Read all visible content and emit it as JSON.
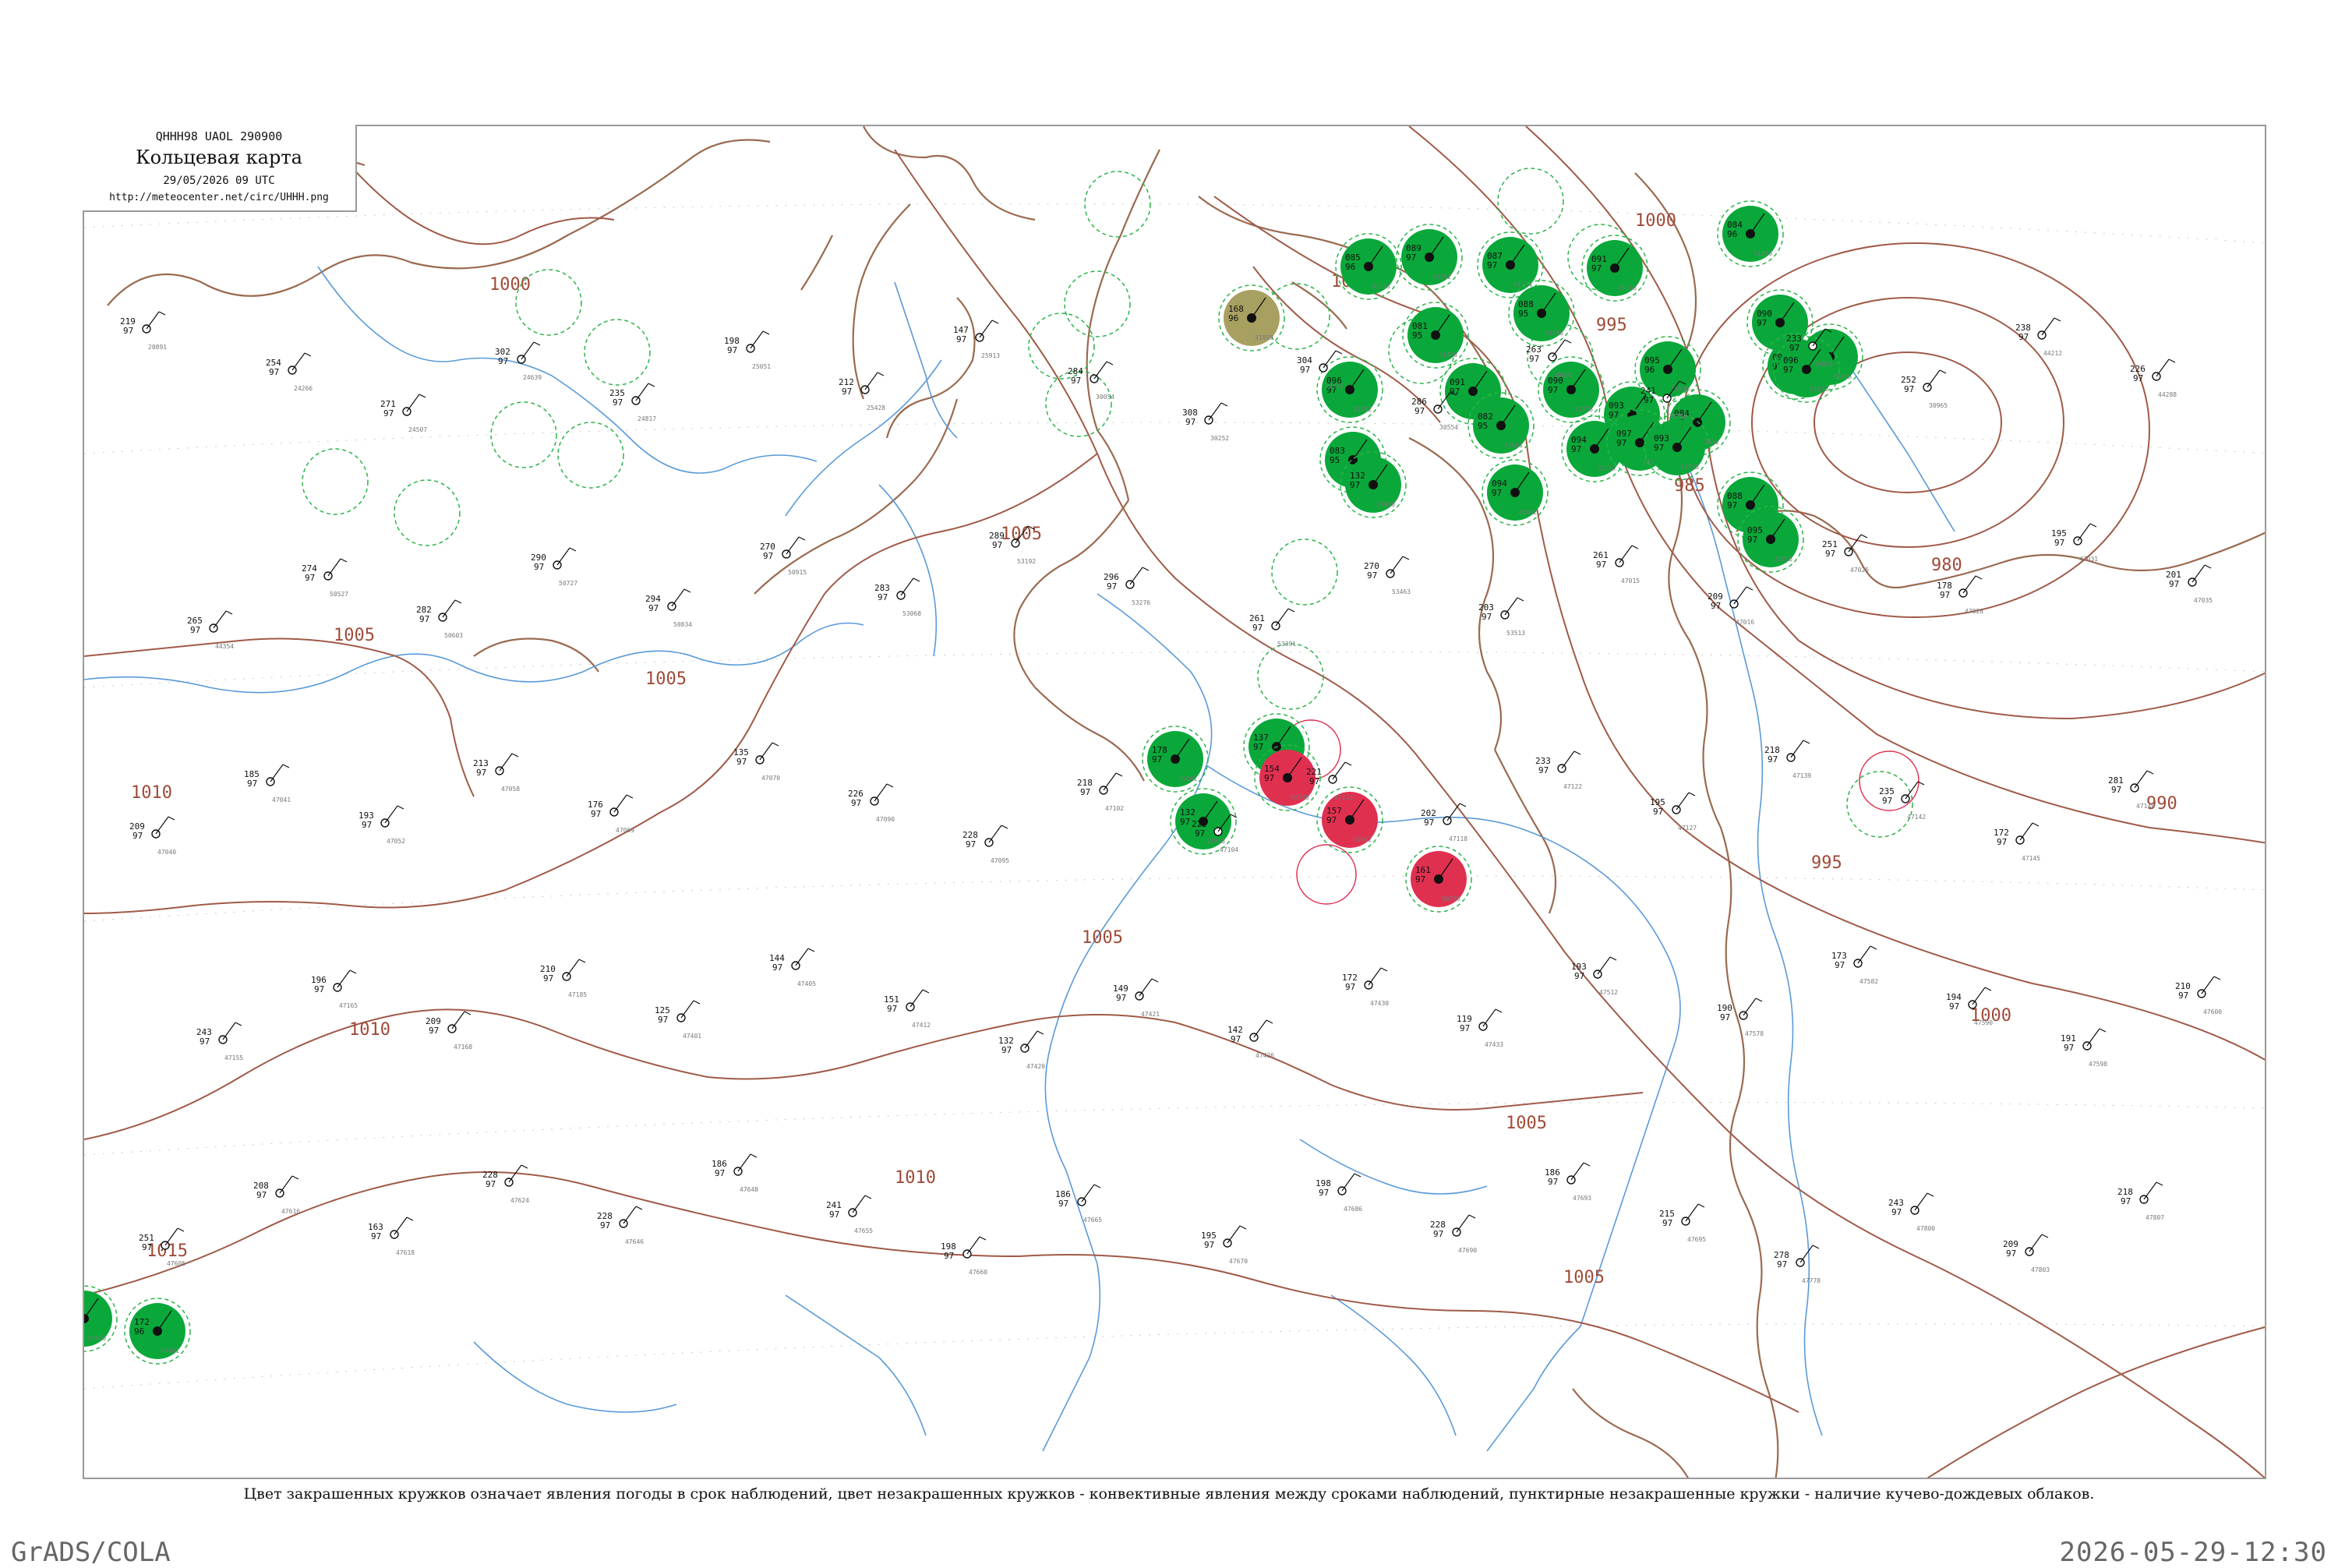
{
  "header": {
    "code": "QHHH98  UAOL  290900",
    "title": "Кольцевая карта",
    "datetime": "29/05/2026 09 UTC",
    "url": "http://meteocenter.net/circ/UHHH.png"
  },
  "caption": "Цвет закрашенных кружков означает явления погоды в срок наблюдений, цвет незакрашенных кружков - конвективные явления между сроками наблюдений, пунктирные незакрашенные кружки - наличие кучево-дождевых облаков.",
  "footer": {
    "left": "GrADS/COLA",
    "right": "2026-05-29-12:30"
  },
  "colors": {
    "isobar": "#a05a48",
    "river": "#4a90d0",
    "coast": "#9a6a50",
    "phenomenon_green": "#0aa83a",
    "phenomenon_red": "#e03050",
    "phenomenon_olive": "#a8a060",
    "cb_dashed": "#2db34a"
  },
  "isobars": [
    {
      "value": "1000"
    },
    {
      "value": "1000"
    },
    {
      "value": "1000"
    },
    {
      "value": "1000"
    },
    {
      "value": "995"
    },
    {
      "value": "995"
    },
    {
      "value": "990"
    },
    {
      "value": "985"
    },
    {
      "value": "980"
    },
    {
      "value": "1005"
    },
    {
      "value": "1005"
    },
    {
      "value": "1005"
    },
    {
      "value": "1005"
    },
    {
      "value": "1005"
    },
    {
      "value": "1005"
    },
    {
      "value": "1010"
    },
    {
      "value": "1010"
    },
    {
      "value": "1010"
    },
    {
      "value": "1015"
    }
  ],
  "stations_filled": [
    {
      "id": "47400",
      "color": "green",
      "t": "162",
      "d": "93"
    },
    {
      "id": "47401",
      "color": "green",
      "t": "172",
      "d": "96"
    },
    {
      "id": "31152",
      "color": "green",
      "t": "089",
      "d": "97"
    },
    {
      "id": "31163",
      "color": "green",
      "t": "085",
      "d": "96"
    },
    {
      "id": "31168",
      "color": "green",
      "t": "091",
      "d": "97"
    },
    {
      "id": "31174",
      "color": "green",
      "t": "087",
      "d": "97"
    },
    {
      "id": "31285",
      "color": "green",
      "t": "088",
      "d": "95"
    },
    {
      "id": "31286",
      "color": "green",
      "t": "084",
      "d": "96"
    },
    {
      "id": "31296",
      "color": "green",
      "t": "090",
      "d": "97"
    },
    {
      "id": "31304",
      "color": "green",
      "t": "092",
      "d": "97"
    },
    {
      "id": "31413",
      "color": "green",
      "t": "086",
      "d": "97"
    },
    {
      "id": "31418",
      "color": "green",
      "t": "081",
      "d": "95"
    },
    {
      "id": "31507",
      "color": "green",
      "t": "093",
      "d": "97"
    },
    {
      "id": "31510",
      "color": "green",
      "t": "095",
      "d": "96"
    },
    {
      "id": "31532",
      "color": "green",
      "t": "094",
      "d": "97"
    },
    {
      "id": "31538",
      "color": "green",
      "t": "091",
      "d": "97"
    },
    {
      "id": "31561",
      "color": "green",
      "t": "082",
      "d": "95"
    },
    {
      "id": "31594",
      "color": "green",
      "t": "083",
      "d": "95"
    },
    {
      "id": "31632",
      "color": "green",
      "t": "084",
      "d": "96"
    },
    {
      "id": "31702",
      "color": "green",
      "t": "096",
      "d": "97"
    },
    {
      "id": "31707",
      "color": "green",
      "t": "094",
      "d": "97"
    },
    {
      "id": "31713",
      "color": "green",
      "t": "097",
      "d": "97"
    },
    {
      "id": "31725",
      "color": "green",
      "t": "093",
      "d": "97"
    },
    {
      "id": "31735",
      "color": "green",
      "t": "090",
      "d": "97"
    },
    {
      "id": "31829",
      "color": "green",
      "t": "088",
      "d": "97"
    },
    {
      "id": "31855",
      "color": "green",
      "t": "095",
      "d": "97"
    },
    {
      "id": "31873",
      "color": "green",
      "t": "096",
      "d": "97"
    },
    {
      "id": "31909",
      "color": "green",
      "t": "137",
      "d": "97"
    },
    {
      "id": "31915",
      "color": "green",
      "t": "132",
      "d": "97"
    },
    {
      "id": "31938",
      "color": "green",
      "t": "132",
      "d": "97"
    },
    {
      "id": "31101",
      "color": "green",
      "t": "178",
      "d": "97"
    },
    {
      "id": "50745",
      "color": "red",
      "t": "154",
      "d": "97"
    },
    {
      "id": "31902",
      "color": "red",
      "t": "157",
      "d": "97"
    },
    {
      "id": "50788",
      "color": "red",
      "t": "161",
      "d": "97"
    },
    {
      "id": "31959",
      "color": "olive",
      "t": "168",
      "d": "96"
    }
  ],
  "stations_plain": [
    {
      "id": "20891",
      "t": "219",
      "d": "97"
    },
    {
      "id": "24266",
      "t": "254",
      "d": "97"
    },
    {
      "id": "24507",
      "t": "271",
      "d": "97"
    },
    {
      "id": "24639",
      "t": "302",
      "d": "97"
    },
    {
      "id": "24817",
      "t": "235",
      "d": "97"
    },
    {
      "id": "25051",
      "t": "198",
      "d": "97"
    },
    {
      "id": "25428",
      "t": "212",
      "d": "97"
    },
    {
      "id": "25913",
      "t": "147",
      "d": "97"
    },
    {
      "id": "30054",
      "t": "284",
      "d": "97"
    },
    {
      "id": "30252",
      "t": "308",
      "d": "97"
    },
    {
      "id": "30372",
      "t": "304",
      "d": "97"
    },
    {
      "id": "30554",
      "t": "286",
      "d": "97"
    },
    {
      "id": "30635",
      "t": "263",
      "d": "97"
    },
    {
      "id": "30758",
      "t": "241",
      "d": "97"
    },
    {
      "id": "30823",
      "t": "233",
      "d": "97"
    },
    {
      "id": "30965",
      "t": "252",
      "d": "97"
    },
    {
      "id": "44212",
      "t": "238",
      "d": "97"
    },
    {
      "id": "44288",
      "t": "226",
      "d": "97"
    },
    {
      "id": "44354",
      "t": "265",
      "d": "97"
    },
    {
      "id": "50527",
      "t": "274",
      "d": "97"
    },
    {
      "id": "50603",
      "t": "282",
      "d": "97"
    },
    {
      "id": "50727",
      "t": "290",
      "d": "97"
    },
    {
      "id": "50834",
      "t": "294",
      "d": "97"
    },
    {
      "id": "50915",
      "t": "270",
      "d": "97"
    },
    {
      "id": "53068",
      "t": "283",
      "d": "97"
    },
    {
      "id": "53192",
      "t": "289",
      "d": "97"
    },
    {
      "id": "53276",
      "t": "296",
      "d": "97"
    },
    {
      "id": "53391",
      "t": "261",
      "d": "97"
    },
    {
      "id": "53463",
      "t": "270",
      "d": "97"
    },
    {
      "id": "53513",
      "t": "203",
      "d": "97"
    },
    {
      "id": "47015",
      "t": "261",
      "d": "97"
    },
    {
      "id": "47016",
      "t": "209",
      "d": "97"
    },
    {
      "id": "47025",
      "t": "251",
      "d": "97"
    },
    {
      "id": "47028",
      "t": "178",
      "d": "97"
    },
    {
      "id": "47031",
      "t": "195",
      "d": "97"
    },
    {
      "id": "47035",
      "t": "201",
      "d": "97"
    },
    {
      "id": "47040",
      "t": "209",
      "d": "97"
    },
    {
      "id": "47041",
      "t": "185",
      "d": "97"
    },
    {
      "id": "47052",
      "t": "193",
      "d": "97"
    },
    {
      "id": "47058",
      "t": "213",
      "d": "97"
    },
    {
      "id": "47069",
      "t": "176",
      "d": "97"
    },
    {
      "id": "47070",
      "t": "135",
      "d": "97"
    },
    {
      "id": "47090",
      "t": "226",
      "d": "97"
    },
    {
      "id": "47095",
      "t": "228",
      "d": "97"
    },
    {
      "id": "47102",
      "t": "218",
      "d": "97"
    },
    {
      "id": "47104",
      "t": "222",
      "d": "97"
    },
    {
      "id": "47112",
      "t": "221",
      "d": "97"
    },
    {
      "id": "47118",
      "t": "202",
      "d": "97"
    },
    {
      "id": "47122",
      "t": "233",
      "d": "97"
    },
    {
      "id": "47127",
      "t": "195",
      "d": "97"
    },
    {
      "id": "47139",
      "t": "218",
      "d": "97"
    },
    {
      "id": "47142",
      "t": "235",
      "d": "97"
    },
    {
      "id": "47145",
      "t": "172",
      "d": "97"
    },
    {
      "id": "47148",
      "t": "281",
      "d": "97"
    },
    {
      "id": "47155",
      "t": "243",
      "d": "97"
    },
    {
      "id": "47165",
      "t": "196",
      "d": "97"
    },
    {
      "id": "47168",
      "t": "209",
      "d": "97"
    },
    {
      "id": "47185",
      "t": "210",
      "d": "97"
    },
    {
      "id": "47401",
      "t": "125",
      "d": "97"
    },
    {
      "id": "47405",
      "t": "144",
      "d": "97"
    },
    {
      "id": "47412",
      "t": "151",
      "d": "97"
    },
    {
      "id": "47420",
      "t": "132",
      "d": "97"
    },
    {
      "id": "47421",
      "t": "149",
      "d": "97"
    },
    {
      "id": "47426",
      "t": "142",
      "d": "97"
    },
    {
      "id": "47430",
      "t": "172",
      "d": "97"
    },
    {
      "id": "47433",
      "t": "119",
      "d": "97"
    },
    {
      "id": "47512",
      "t": "193",
      "d": "97"
    },
    {
      "id": "47578",
      "t": "190",
      "d": "97"
    },
    {
      "id": "47582",
      "t": "173",
      "d": "97"
    },
    {
      "id": "47590",
      "t": "194",
      "d": "97"
    },
    {
      "id": "47598",
      "t": "191",
      "d": "97"
    },
    {
      "id": "47600",
      "t": "210",
      "d": "97"
    },
    {
      "id": "47605",
      "t": "251",
      "d": "97"
    },
    {
      "id": "47616",
      "t": "208",
      "d": "97"
    },
    {
      "id": "47618",
      "t": "163",
      "d": "97"
    },
    {
      "id": "47624",
      "t": "228",
      "d": "97"
    },
    {
      "id": "47646",
      "t": "228",
      "d": "97"
    },
    {
      "id": "47648",
      "t": "186",
      "d": "97"
    },
    {
      "id": "47655",
      "t": "241",
      "d": "97"
    },
    {
      "id": "47660",
      "t": "198",
      "d": "97"
    },
    {
      "id": "47665",
      "t": "186",
      "d": "97"
    },
    {
      "id": "47670",
      "t": "195",
      "d": "97"
    },
    {
      "id": "47686",
      "t": "198",
      "d": "97"
    },
    {
      "id": "47690",
      "t": "228",
      "d": "97"
    },
    {
      "id": "47693",
      "t": "186",
      "d": "97"
    },
    {
      "id": "47695",
      "t": "215",
      "d": "97"
    },
    {
      "id": "47778",
      "t": "278",
      "d": "97"
    },
    {
      "id": "47800",
      "t": "243",
      "d": "97"
    },
    {
      "id": "47803",
      "t": "209",
      "d": "97"
    },
    {
      "id": "47807",
      "t": "218",
      "d": "97"
    }
  ]
}
